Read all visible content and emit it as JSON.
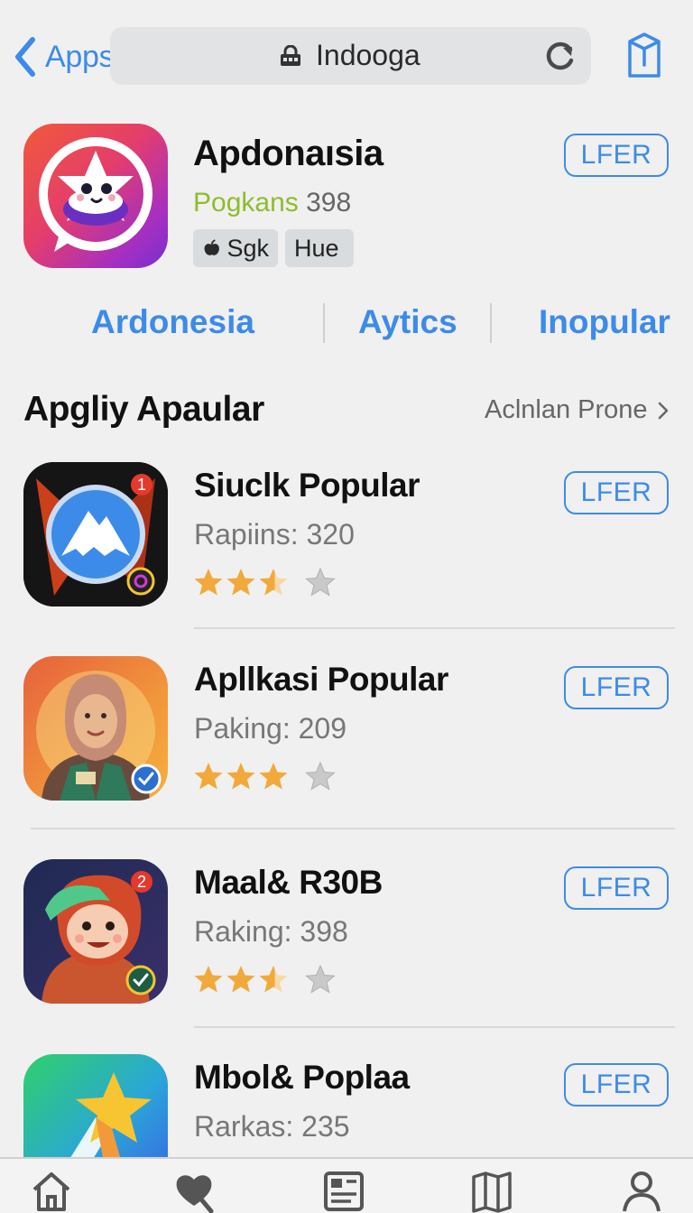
{
  "nav": {
    "back_label": "Appsok",
    "url_text": "Indooga"
  },
  "featured": {
    "title": "Apdonaısia",
    "category": "Pogkans",
    "count": "398",
    "chips": [
      "Sgk",
      "Hue"
    ],
    "button_label": "LFER"
  },
  "tabs": [
    "Ardonesia",
    "Aytics",
    "Inopular"
  ],
  "section": {
    "title": "Apgliy Apaular",
    "link_label": "Aclnlan Prone"
  },
  "apps": [
    {
      "name": "Siuclk Popular",
      "rank": "Rapiins: 320",
      "rating": 2.5,
      "button_label": "LFER",
      "badge": "1"
    },
    {
      "name": "Apllkasi Popular",
      "rank": "Paking: 209",
      "rating": 3,
      "button_label": "LFER",
      "badge": ""
    },
    {
      "name": "Maal& R30B",
      "rank": "Raking: 398",
      "rating": 2.5,
      "button_label": "LFER",
      "badge": "2"
    },
    {
      "name": "Mbol& Poplaa",
      "rank": "Rarkas: 235",
      "rating": 0,
      "button_label": "LFER",
      "badge": ""
    }
  ],
  "tabbar": [
    "home-icon",
    "heart-icon",
    "news-icon",
    "book-icon",
    "profile-icon"
  ],
  "colors": {
    "accent": "#3d8be8",
    "star": "#f2a93b",
    "category_green": "#8dbd2a",
    "background": "#f0f0f0"
  }
}
